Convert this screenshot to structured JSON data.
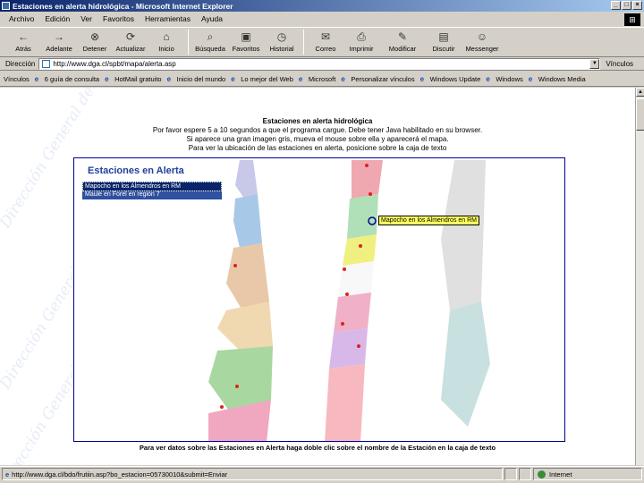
{
  "window": {
    "title": "Estaciones en alerta hidrológica - Microsoft Internet Explorer",
    "controls": [
      "_",
      "□",
      "×"
    ]
  },
  "menu": [
    "Archivo",
    "Edición",
    "Ver",
    "Favoritos",
    "Herramientas",
    "Ayuda"
  ],
  "toolbar": [
    {
      "label": "Atrás",
      "icon": "back-arrow-icon",
      "glyph": "←"
    },
    {
      "label": "Adelante",
      "icon": "forward-arrow-icon",
      "glyph": "→"
    },
    {
      "label": "Detener",
      "icon": "stop-icon",
      "glyph": "⊗"
    },
    {
      "label": "Actualizar",
      "icon": "refresh-icon",
      "glyph": "⟳"
    },
    {
      "label": "Inicio",
      "icon": "home-icon",
      "glyph": "⌂"
    },
    {
      "label": "Búsqueda",
      "icon": "search-icon",
      "glyph": "⌕"
    },
    {
      "label": "Favoritos",
      "icon": "favorites-icon",
      "glyph": "▣"
    },
    {
      "label": "Historial",
      "icon": "history-icon",
      "glyph": "◷"
    },
    {
      "label": "Correo",
      "icon": "mail-icon",
      "glyph": "✉"
    },
    {
      "label": "Imprimir",
      "icon": "print-icon",
      "glyph": "⎙"
    },
    {
      "label": "Modificar",
      "icon": "edit-icon",
      "glyph": "✎"
    },
    {
      "label": "Discutir",
      "icon": "discuss-icon",
      "glyph": "▤"
    },
    {
      "label": "Messenger",
      "icon": "messenger-icon",
      "glyph": "☺"
    }
  ],
  "address": {
    "label": "Dirección",
    "url": "http://www.dga.cl/spbt/mapa/alerta.asp",
    "links_label": "Vínculos"
  },
  "links": [
    "Vínculos",
    "6 guía de consulta",
    "HotMail gratuito",
    "Inicio del mundo",
    "Lo mejor del Web",
    "Microsoft",
    "Personalizar vínculos",
    "Windows Update",
    "Windows",
    "Windows Media"
  ],
  "page": {
    "heading": "Estaciones en alerta hidrológica",
    "lines": [
      "Por favor espere 5 a 10 segundos a que el programa cargue. Debe tener Java habilitado en su browser.",
      "Si aparece una gran imagen gris, mueva el mouse sobre ella y aparecerá el mapa.",
      "Para ver la ubicación de las estaciones en alerta, posicione sobre la caja de texto"
    ],
    "watermark": "Dirección General de Aguas",
    "map_title": "Estaciones en Alerta",
    "alert_list": [
      "Mapocho en los Almendros en RM",
      "Maule en Forel en región 7"
    ],
    "tooltip": "Mapocho en los Almendros en RM",
    "footer": "Para ver datos sobre las Estaciones en Alerta haga doble clic sobre el nombre de la Estación en la caja de texto"
  },
  "status": {
    "text": "http://www.dga.cl/bdo/frutiin.asp?bo_estacion=05730010&submit=Enviar",
    "zone": "Internet"
  }
}
